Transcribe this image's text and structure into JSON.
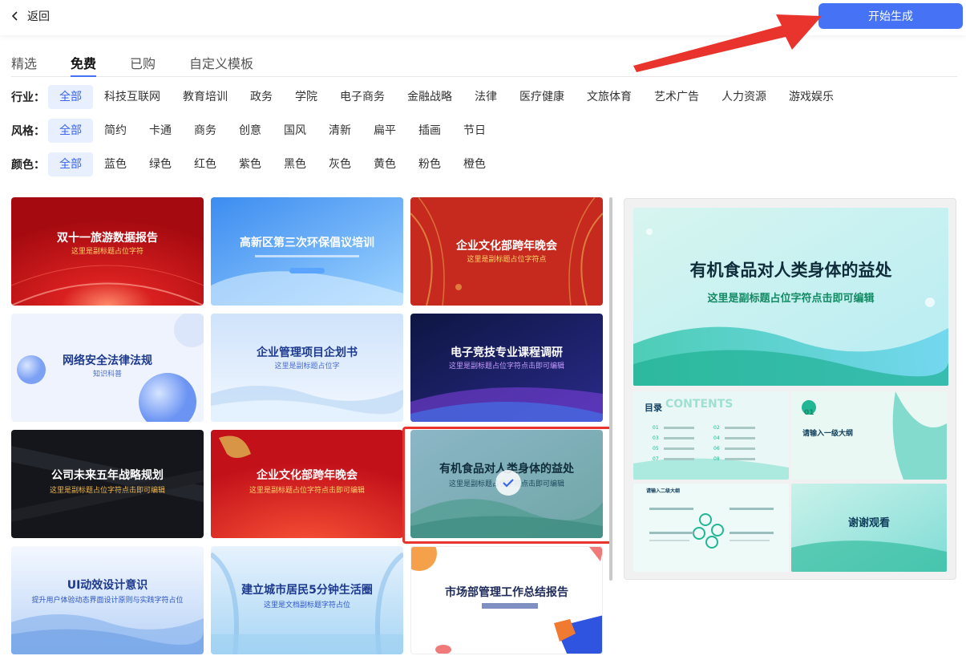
{
  "header": {
    "back_label": "返回",
    "start_label": "开始生成"
  },
  "tabs": [
    {
      "label": "精选",
      "active": false
    },
    {
      "label": "免费",
      "active": true
    },
    {
      "label": "已购",
      "active": false
    },
    {
      "label": "自定义模板",
      "active": false
    }
  ],
  "filters": {
    "industry": {
      "label": "行业：",
      "options": [
        "全部",
        "科技互联网",
        "教育培训",
        "政务",
        "学院",
        "电子商务",
        "金融战略",
        "法律",
        "医疗健康",
        "文旅体育",
        "艺术广告",
        "人力资源",
        "游戏娱乐"
      ]
    },
    "style": {
      "label": "风格：",
      "options": [
        "全部",
        "简约",
        "卡通",
        "商务",
        "创意",
        "国风",
        "清新",
        "扁平",
        "插画",
        "节日"
      ]
    },
    "color": {
      "label": "颜色：",
      "options": [
        "全部",
        "蓝色",
        "绿色",
        "红色",
        "紫色",
        "黑色",
        "灰色",
        "黄色",
        "粉色",
        "橙色"
      ]
    }
  },
  "templates": [
    {
      "title": "双十一旅游数据报告",
      "subtitle": "这里是副标题占位字符"
    },
    {
      "title": "高新区第三次环保倡议培训",
      "subtitle": ""
    },
    {
      "title": "企业文化部跨年晚会",
      "subtitle": "这里是副标题占位字符点"
    },
    {
      "title": "网络安全法律法规",
      "subtitle": "知识科普"
    },
    {
      "title": "企业管理项目企划书",
      "subtitle": "这里是副标题占位字"
    },
    {
      "title": "电子竞技专业课程调研",
      "subtitle": "这里是副标题占位字符点击即可编辑"
    },
    {
      "title": "公司未来五年战略规划",
      "subtitle": "这里是副标题占位字符点击即可编辑"
    },
    {
      "title": "企业文化部跨年晚会",
      "subtitle": "这里是副标题占位字符点击即可编辑"
    },
    {
      "title": "有机食品对人类身体的益处",
      "subtitle": "这里是副标题占位字符点击即可编辑"
    },
    {
      "title": "UI动效设计意识",
      "subtitle": "提升用户体验动态界面设计原则与实践字符占位"
    },
    {
      "title": "建立城市居民5分钟生活圈",
      "subtitle": "这里是文档副标题字符占位"
    },
    {
      "title": "市场部管理工作总结报告",
      "subtitle": ""
    }
  ],
  "selected_index": 8,
  "preview": {
    "main_title": "有机食品对人类身体的益处",
    "main_subtitle": "这里是副标题占位字符点击即可编辑",
    "toc_title": "目录",
    "toc_watermark": "CONTENTS",
    "toc_numbers": [
      "01",
      "02",
      "03",
      "04",
      "05",
      "06",
      "07",
      "08"
    ],
    "section_number": "01",
    "section_title": "请输入一级大纲",
    "slide3_title": "请输入二级大纲",
    "thanks": "谢谢观看"
  },
  "colors": {
    "accent": "#4673f5",
    "selection": "#e8342c",
    "chip_active_bg": "#e8efff"
  }
}
